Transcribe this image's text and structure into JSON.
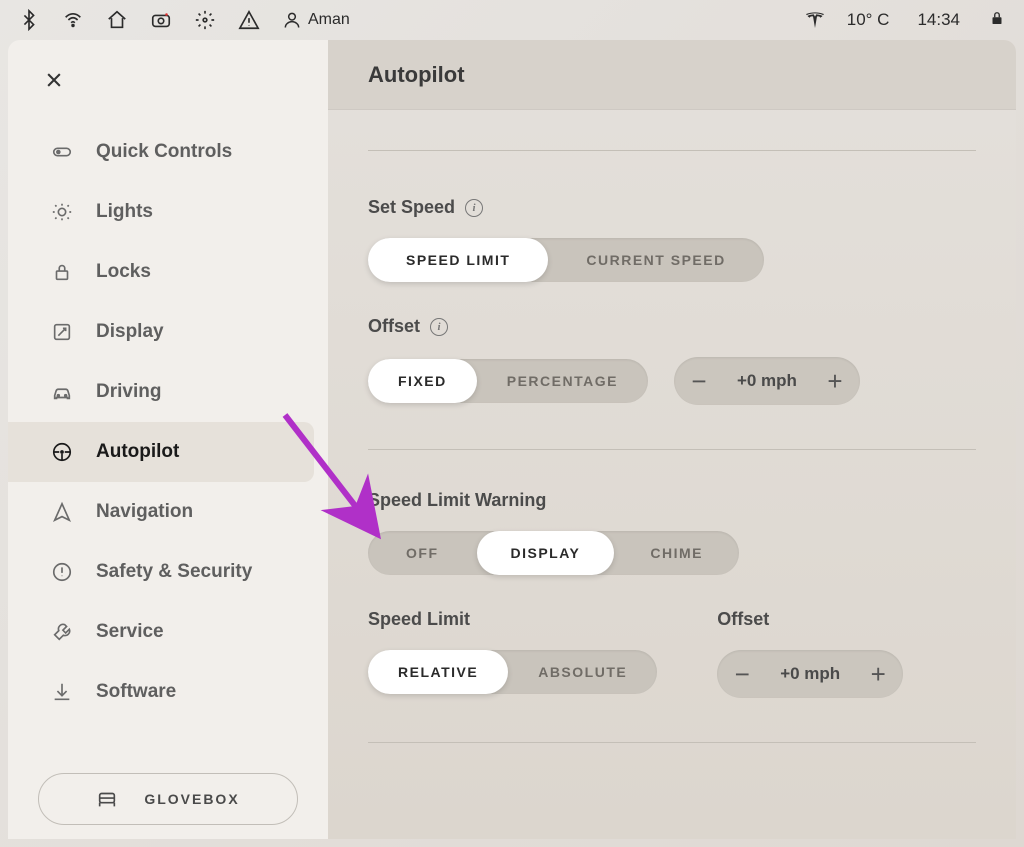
{
  "status": {
    "profile_name": "Aman",
    "temperature": "10° C",
    "time": "14:34"
  },
  "sidebar": {
    "items": [
      {
        "label": "Quick Controls"
      },
      {
        "label": "Lights"
      },
      {
        "label": "Locks"
      },
      {
        "label": "Display"
      },
      {
        "label": "Driving"
      },
      {
        "label": "Autopilot"
      },
      {
        "label": "Navigation"
      },
      {
        "label": "Safety & Security"
      },
      {
        "label": "Service"
      },
      {
        "label": "Software"
      }
    ],
    "glovebox": "GLOVEBOX"
  },
  "page": {
    "title": "Autopilot",
    "set_speed": {
      "label": "Set Speed",
      "options": {
        "a": "SPEED LIMIT",
        "b": "CURRENT SPEED"
      },
      "selected": "a"
    },
    "offset": {
      "label": "Offset",
      "options": {
        "a": "FIXED",
        "b": "PERCENTAGE"
      },
      "selected": "a",
      "value": "+0 mph"
    },
    "speed_limit_warning": {
      "label": "Speed Limit Warning",
      "options": {
        "a": "OFF",
        "b": "DISPLAY",
        "c": "CHIME"
      },
      "selected": "b"
    },
    "speed_limit": {
      "label": "Speed Limit",
      "options": {
        "a": "RELATIVE",
        "b": "ABSOLUTE"
      },
      "selected": "a"
    },
    "offset2": {
      "label": "Offset",
      "value": "+0 mph"
    }
  }
}
